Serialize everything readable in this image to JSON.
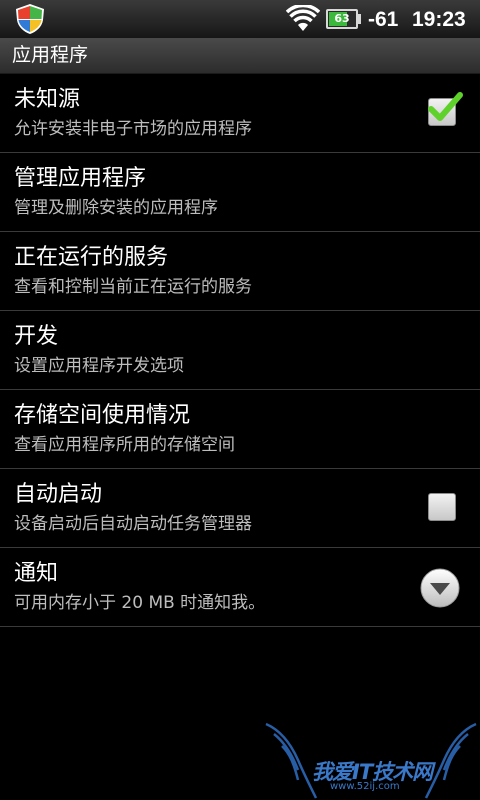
{
  "status_bar": {
    "battery_level": "63",
    "signal_strength": "-61",
    "time": "19:23",
    "icons": [
      "shield-icon",
      "wifi-icon",
      "battery-icon"
    ],
    "colors": {
      "battery_fill": "#3cb83c"
    }
  },
  "header": {
    "title": "应用程序"
  },
  "settings": {
    "items": [
      {
        "title": "未知源",
        "summary": "允许安装非电子市场的应用程序",
        "control": "checkbox",
        "checked": true
      },
      {
        "title": "管理应用程序",
        "summary": "管理及删除安装的应用程序"
      },
      {
        "title": "正在运行的服务",
        "summary": "查看和控制当前正在运行的服务"
      },
      {
        "title": "开发",
        "summary": "设置应用程序开发选项"
      },
      {
        "title": "存储空间使用情况",
        "summary": "查看应用程序所用的存储空间"
      },
      {
        "title": "自动启动",
        "summary": "设备启动后自动启动任务管理器",
        "control": "checkbox",
        "checked": false
      },
      {
        "title": "通知",
        "summary": "可用内存小于 20 MB 时通知我。",
        "control": "dropdown"
      }
    ]
  },
  "watermark": {
    "text": "我爱IT技术网",
    "url": "www.52ij.com"
  }
}
